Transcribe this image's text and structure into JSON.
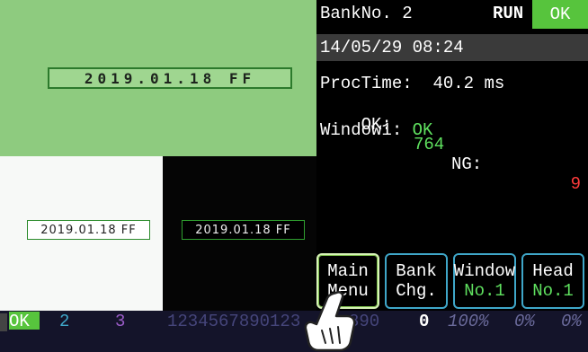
{
  "images": {
    "top_ocr": "2019.01.18 FF",
    "bottom_left_ocr": "2019.01.18 FF",
    "bottom_right_ocr": "2019.01.18 FF"
  },
  "info": {
    "bank_label": "BankNo. 2",
    "run_label": "RUN",
    "result_badge": "OK",
    "datetime": "14/05/29 08:24",
    "proctime_label": "ProcTime:",
    "proctime_value": "40.2 ms",
    "ok_label": "OK:",
    "ok_count": "764",
    "ng_label": "NG:",
    "ng_count": "9",
    "window_label": "Window1:",
    "window_result": "OK"
  },
  "buttons": [
    {
      "line1": "Main",
      "line2": "Menu"
    },
    {
      "line1": "Bank",
      "line2": "Chg."
    },
    {
      "line1": "Window",
      "line2": "No.1"
    },
    {
      "line1": "Head",
      "line2": "No.1"
    }
  ],
  "statusbar": {
    "ok": "OK",
    "s2": "2",
    "s3": "3",
    "digits": "1234567890123",
    "digits_tail": "890",
    "zero": "0",
    "pct1": "100%",
    "pct2": "0%",
    "pct3": "0%",
    "colors": {
      "green": "#57c43d",
      "cyan": "#3fa7c9",
      "purple": "#9a5cc8"
    }
  }
}
